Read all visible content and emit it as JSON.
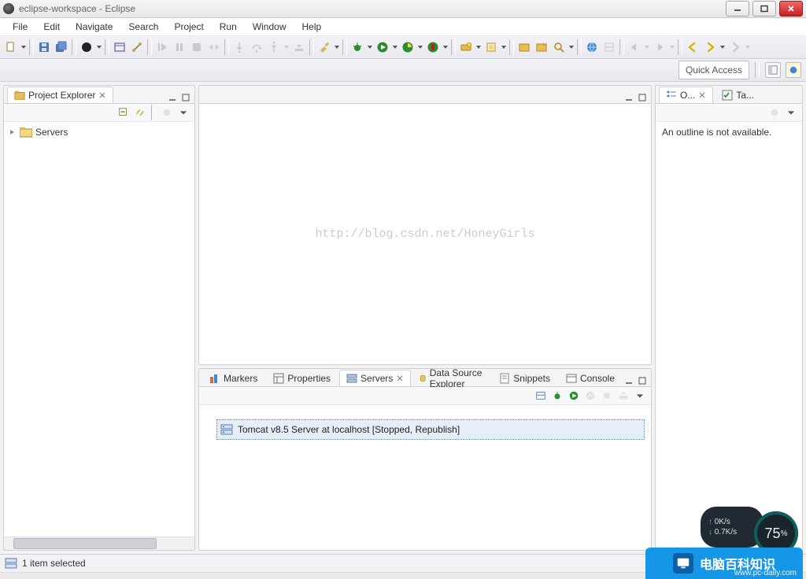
{
  "window": {
    "title": "eclipse-workspace - Eclipse"
  },
  "menu": [
    "File",
    "Edit",
    "Navigate",
    "Search",
    "Project",
    "Run",
    "Window",
    "Help"
  ],
  "quick_access": {
    "label": "Quick Access"
  },
  "project_explorer": {
    "tab_label": "Project Explorer",
    "tree": [
      {
        "label": "Servers"
      }
    ]
  },
  "editor_watermark": "http://blog.csdn.net/HoneyGirls",
  "outline": {
    "tab1_label": "O...",
    "tab2_label": "Ta...",
    "empty_text": "An outline is not available."
  },
  "bottom_tabs": {
    "markers": "Markers",
    "properties": "Properties",
    "servers": "Servers",
    "data_source_explorer": "Data Source Explorer",
    "snippets": "Snippets",
    "console": "Console"
  },
  "servers_view": {
    "item": "Tomcat v8.5 Server at localhost  [Stopped, Republish]"
  },
  "status": {
    "text": "1 item selected"
  },
  "net_overlay": {
    "up": "0K/s",
    "down": "0.7K/s",
    "pct": "75",
    "pct_unit": "%"
  },
  "brand": {
    "text": "电脑百科知识",
    "url": "www.pc-daily.com"
  }
}
